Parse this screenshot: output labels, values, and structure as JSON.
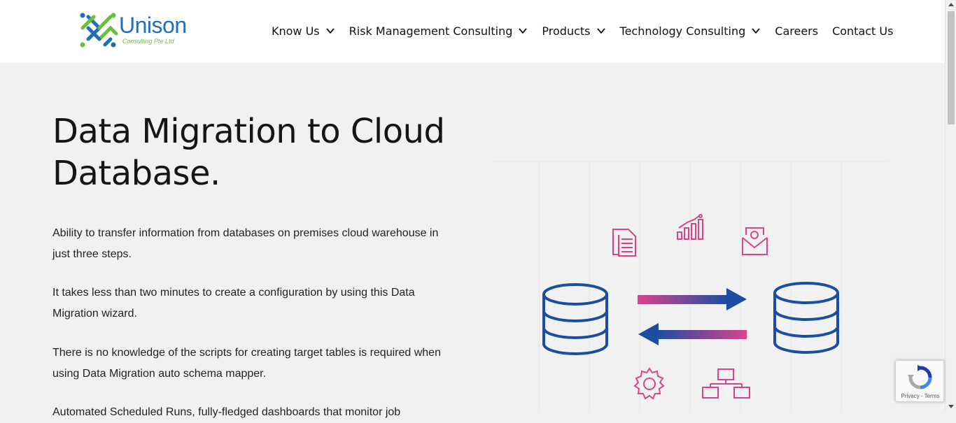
{
  "logo": {
    "name": "Unison",
    "tagline": "Consulting Pte Ltd"
  },
  "nav": [
    {
      "label": "Know Us",
      "dropdown": true
    },
    {
      "label": "Risk Management Consulting",
      "dropdown": true
    },
    {
      "label": "Products",
      "dropdown": true
    },
    {
      "label": "Technology Consulting",
      "dropdown": true
    },
    {
      "label": "Careers",
      "dropdown": false
    },
    {
      "label": "Contact Us",
      "dropdown": false
    }
  ],
  "hero": {
    "title_line1": "Data Migration to Cloud",
    "title_line2": "Database.",
    "paragraphs": [
      "Ability to transfer information from databases on premises cloud warehouse in just three steps.",
      "It takes less than two minutes to create a configuration by using this Data Migration wizard.",
      "There is no knowledge of the scripts for creating target tables is required when using Data Migration auto schema mapper.",
      "Automated Scheduled Runs, fully-fledged dashboards that monitor job"
    ]
  },
  "recaptcha": {
    "privacy": "Privacy",
    "terms": "Terms",
    "separator": " - "
  },
  "colors": {
    "brand_blue": "#1f6fb7",
    "brand_green": "#6cbf3a",
    "illus_pink": "#d9438b",
    "illus_blue": "#1b4ea0"
  }
}
